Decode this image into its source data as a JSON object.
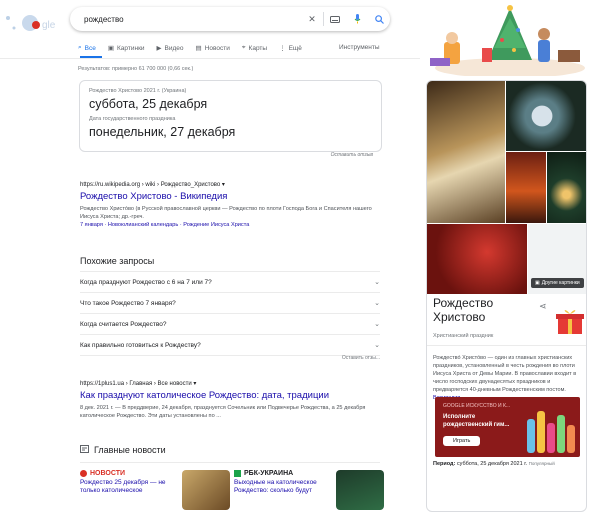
{
  "search": {
    "query": "рождество"
  },
  "tabs": [
    {
      "label": "Все",
      "icon": "search-icon"
    },
    {
      "label": "Картинки",
      "icon": "image-icon"
    },
    {
      "label": "Видео",
      "icon": "video-icon"
    },
    {
      "label": "Новости",
      "icon": "news-icon"
    },
    {
      "label": "Карты",
      "icon": "map-pin-icon"
    },
    {
      "label": "Ещё",
      "icon": "more-vert-icon"
    }
  ],
  "tools_label": "Инструменты",
  "stats": "Результатов: примерно 61 700 000 (0,66 сек.)",
  "answer_card": {
    "label1": "Рождество Христово 2021 г. (Украина)",
    "value1": "суббота, 25 декабря",
    "label2": "Дата государственного праздника",
    "value2": "понедельник, 27 декабря"
  },
  "feedback_label": "Оставить отзыв",
  "result1": {
    "url": "https://ru.wikipedia.org › wiki › Рождество_Христово ▾",
    "title": "Рождество Христово - Википедия",
    "snippet": "Рождество Христо́во (в Русской православной церкви — Рождество по плоти Господа Бога и Спасителя нашего Иисуса Христа; др.-греч.",
    "links": [
      "7 января",
      "Новоюлианский календарь",
      "Рождение Иисуса Христа"
    ]
  },
  "people_also_ask": {
    "heading": "Похожие запросы",
    "items": [
      "Когда празднуют Рождество с 6 на 7 или 7?",
      "Что такое Рождество 7 января?",
      "Когда считается Рождество?",
      "Как правильно готовиться к Рождеству?"
    ],
    "feedback": "Оставить отзы..."
  },
  "result2": {
    "url": "https://1plus1.ua › Главная › Все новости ▾",
    "title": "Как празднуют католическое Рождество: дата, традиции",
    "snippet": "8 дек. 2021 г. — В преддверие, 24 декабря, празднуется Сочельник или Подвечерье Рождества, а 25 декабря католическое Рождество. Эти даты установлены по ..."
  },
  "news": {
    "heading": "Главные новости",
    "items": [
      {
        "source": "НОВОСТИ",
        "title": "Рождество 25 декабря — не только католическое",
        "color": "#d93025"
      },
      {
        "source": "РБК-УКРАИНА",
        "title": "Выходные на католическое Рождество: сколько будут",
        "color": "#202124"
      }
    ]
  },
  "knowledge_panel": {
    "title": "Рождество Христово",
    "subtitle": "Христианский праздник",
    "more_images": "Другие картинки",
    "description": "Рождество́ Христо́во — один из главных христианских праздников, установленный в честь рождения во плоти Иисуса Христа от Девы Марии. В православии входит в число господских двунадесятых праздников и предваряется 40-дневным Рождественским постом.",
    "description_source": "Википедия",
    "promo": {
      "tag": "GOOGLE ИСКУССТВО И К...",
      "text": "Исполните рождественский гим...",
      "button": "Играть"
    },
    "period_label": "Период:",
    "period_value": "суббота, 25 декабря 2021 г.",
    "period_note": "Популярный"
  },
  "colors": {
    "accent": "#1a73e8",
    "link": "#1a0dab",
    "promo_bg": "#8b1a1a"
  }
}
